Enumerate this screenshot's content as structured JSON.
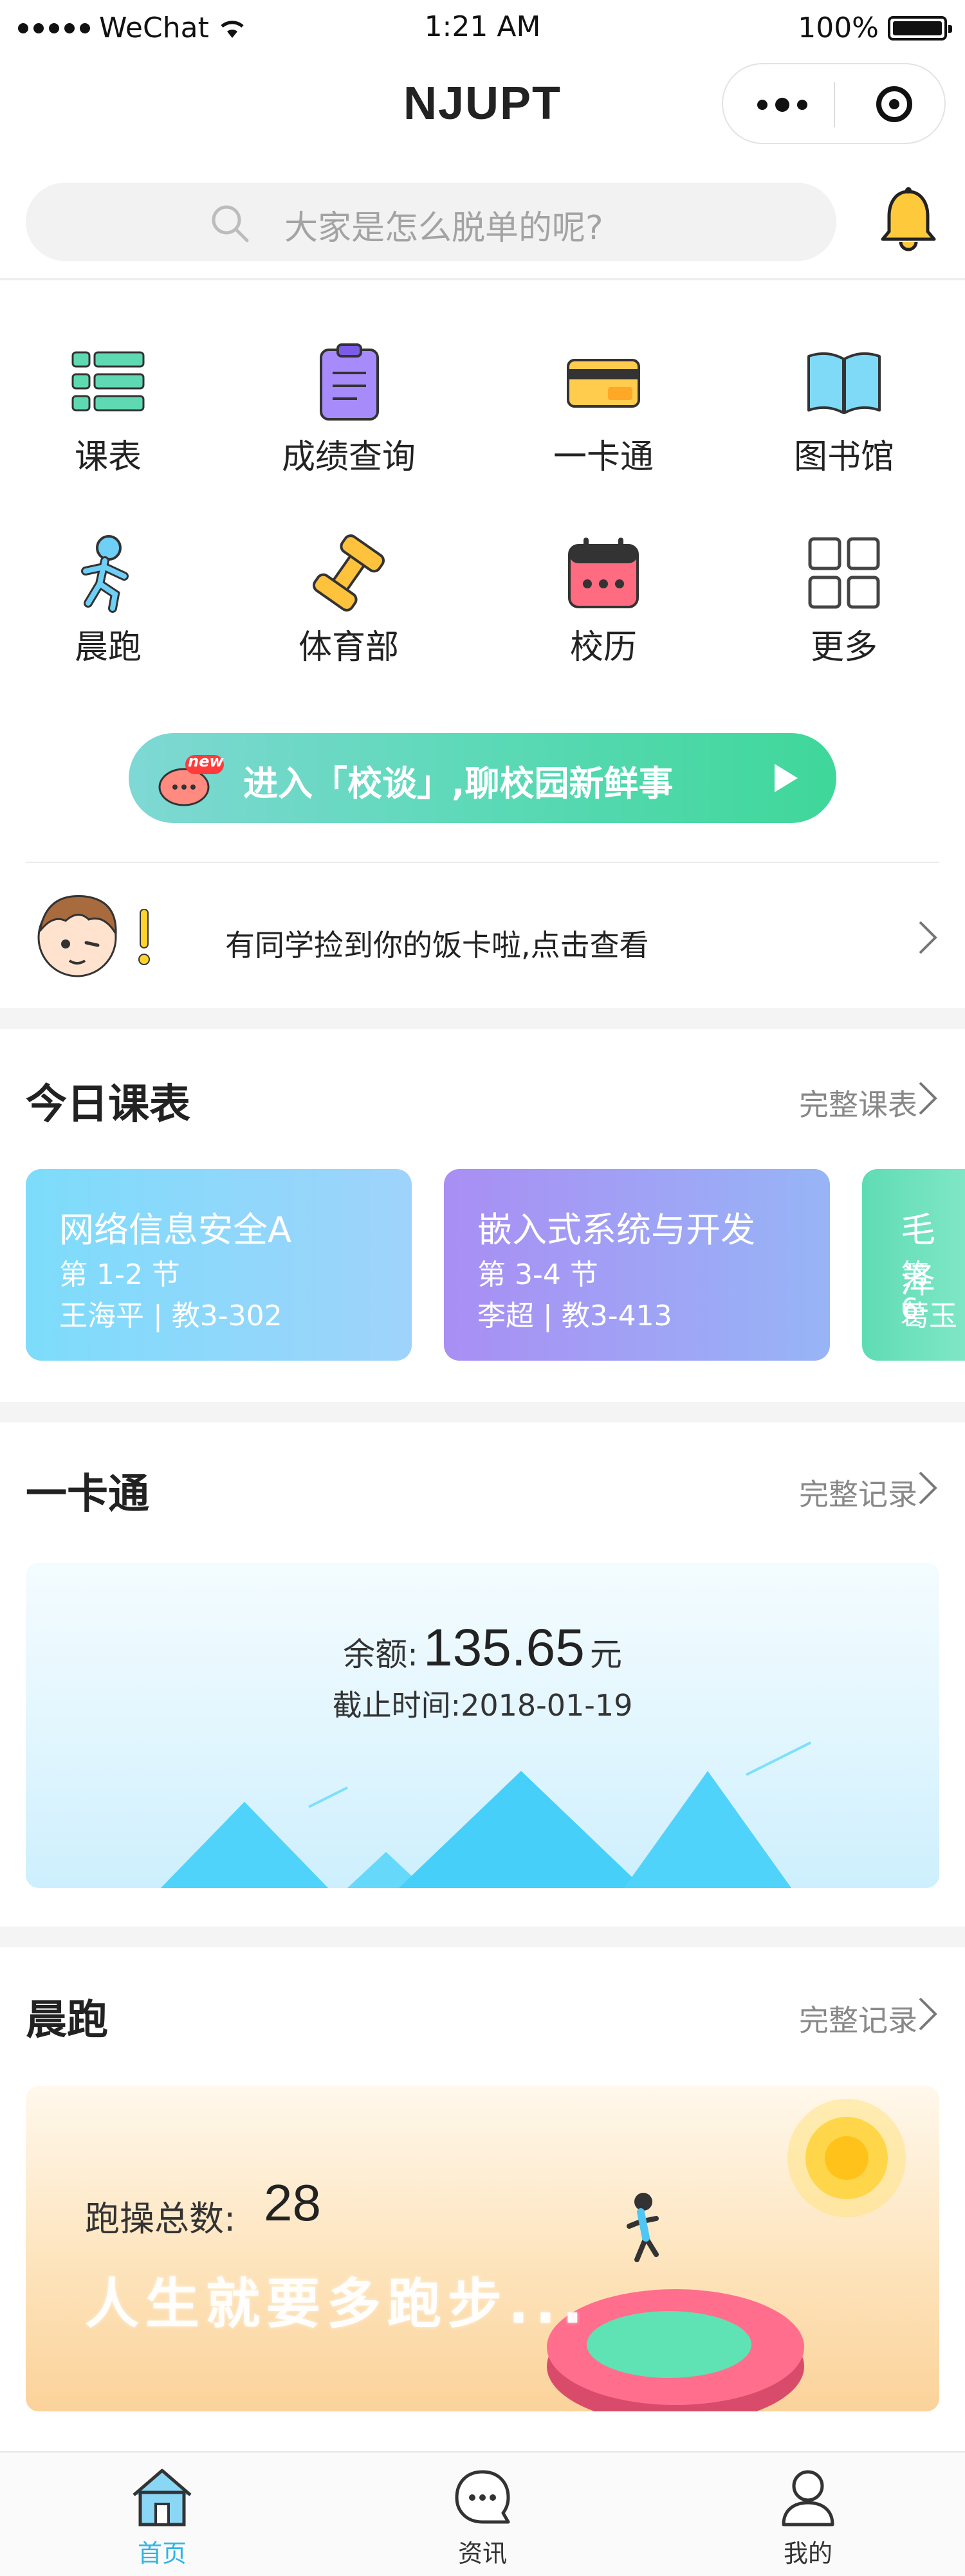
{
  "status_bar": {
    "carrier": "WeChat",
    "time": "1:21 AM",
    "battery": "100%"
  },
  "header": {
    "title": "NJUPT"
  },
  "search": {
    "placeholder": "大家是怎么脱单的呢?"
  },
  "grid": [
    {
      "label": "课表",
      "icon": "list-icon"
    },
    {
      "label": "成绩查询",
      "icon": "clipboard-icon"
    },
    {
      "label": "一卡通",
      "icon": "card-icon"
    },
    {
      "label": "图书馆",
      "icon": "book-icon"
    },
    {
      "label": "晨跑",
      "icon": "runner-icon"
    },
    {
      "label": "体育部",
      "icon": "dumbbell-icon"
    },
    {
      "label": "校历",
      "icon": "calendar-icon"
    },
    {
      "label": "更多",
      "icon": "grid-icon"
    }
  ],
  "banner": {
    "badge": "new",
    "text": "进入「校谈」,聊校园新鲜事"
  },
  "notice": {
    "text": "有同学捡到你的饭卡啦,点击查看"
  },
  "schedule": {
    "title": "今日课表",
    "more": "完整课表",
    "courses": [
      {
        "name": "网络信息安全A",
        "session": "第 1-2 节",
        "teacher": "王海平 | 教3-302",
        "color_from": "#7ddcfb",
        "color_to": "#9fd3fb"
      },
      {
        "name": "嵌入式系统与开发",
        "session": "第 3-4 节",
        "teacher": "李超 | 教3-413",
        "color_from": "#a98ef4",
        "color_to": "#97b5f6"
      },
      {
        "name": "毛泽",
        "session": "第 6-",
        "teacher": "葛玉",
        "color_from": "#5fdcb4",
        "color_to": "#7fe6c6"
      }
    ]
  },
  "ecard": {
    "title": "一卡通",
    "more": "完整记录",
    "balance_label": "余额:",
    "balance": "135.65",
    "unit": "元",
    "date": "截止时间:2018-01-19"
  },
  "morning_run": {
    "title": "晨跑",
    "more": "完整记录",
    "count_label": "跑操总数:",
    "count": "28",
    "slogan": "人生就要多跑步..."
  },
  "tabbar": [
    {
      "label": "首页",
      "icon": "home-icon",
      "active": true
    },
    {
      "label": "资讯",
      "icon": "chat-icon",
      "active": false
    },
    {
      "label": "我的",
      "icon": "profile-icon",
      "active": false
    }
  ],
  "colors": {
    "accent": "#2fb4e6",
    "banner_green": "#4fd8a6",
    "bell": "#ffc93c"
  }
}
